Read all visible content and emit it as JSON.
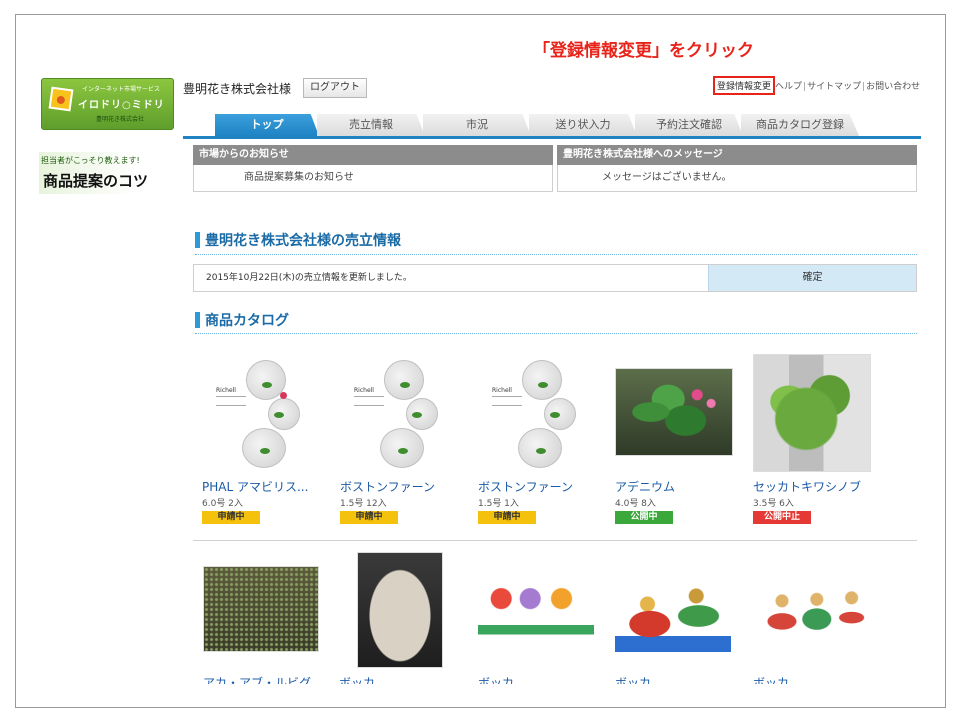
{
  "instruction": "「登録情報変更」をクリック",
  "logo": {
    "sub_top": "インターネット市場サービス",
    "brand": "イロドリ○ミドリ",
    "sub_bottom": "豊明花き株式会社"
  },
  "header": {
    "company": "豊明花き株式会社様",
    "logout": "ログアウト",
    "links": [
      "登録情報変更",
      "ヘルプ",
      "サイトマップ",
      "お問い合わせ"
    ]
  },
  "tabs": [
    "トップ",
    "売立情報",
    "市況",
    "送り状入力",
    "予約注文確認",
    "商品カタログ登録"
  ],
  "side_banner": {
    "small": "担当者がこっそり教えます!",
    "big": "商品提案のコツ"
  },
  "notices": {
    "market_title": "市場からのお知らせ",
    "market_body": "商品提案募集のお知らせ",
    "message_title": "豊明花き株式会社様へのメッセージ",
    "message_body": "メッセージはございません。"
  },
  "sales": {
    "title": "豊明花き株式会社様の売立情報",
    "text": "2015年10月22日(木)の売立情報を更新しました。",
    "confirm": "確定"
  },
  "catalog": {
    "title": "商品カタログ",
    "items": [
      {
        "name": "PHAL アマビリス...",
        "meta": "6.0号 2入",
        "status": "申請中"
      },
      {
        "name": "ボストンファーン",
        "meta": "1.5号 12入",
        "status": "申請中"
      },
      {
        "name": "ボストンファーン",
        "meta": "1.5号 1入",
        "status": "申請中"
      },
      {
        "name": "アデニウム",
        "meta": "4.0号 8入",
        "status": "公開中"
      },
      {
        "name": "セッカトキワシノブ",
        "meta": "3.5号 6入",
        "status": "公開中止"
      }
    ],
    "row2_names": [
      "アカ・アブ・ルビグ",
      "ボッカ",
      "ボッカ",
      "ボッカ",
      "ボッカ"
    ],
    "richell_label": "Richell"
  },
  "colors": {
    "accent": "#1f83c4",
    "highlight": "#e8231a",
    "status_pending": "#f4c20d",
    "status_public": "#3aa83a",
    "status_stopped": "#e53935"
  }
}
